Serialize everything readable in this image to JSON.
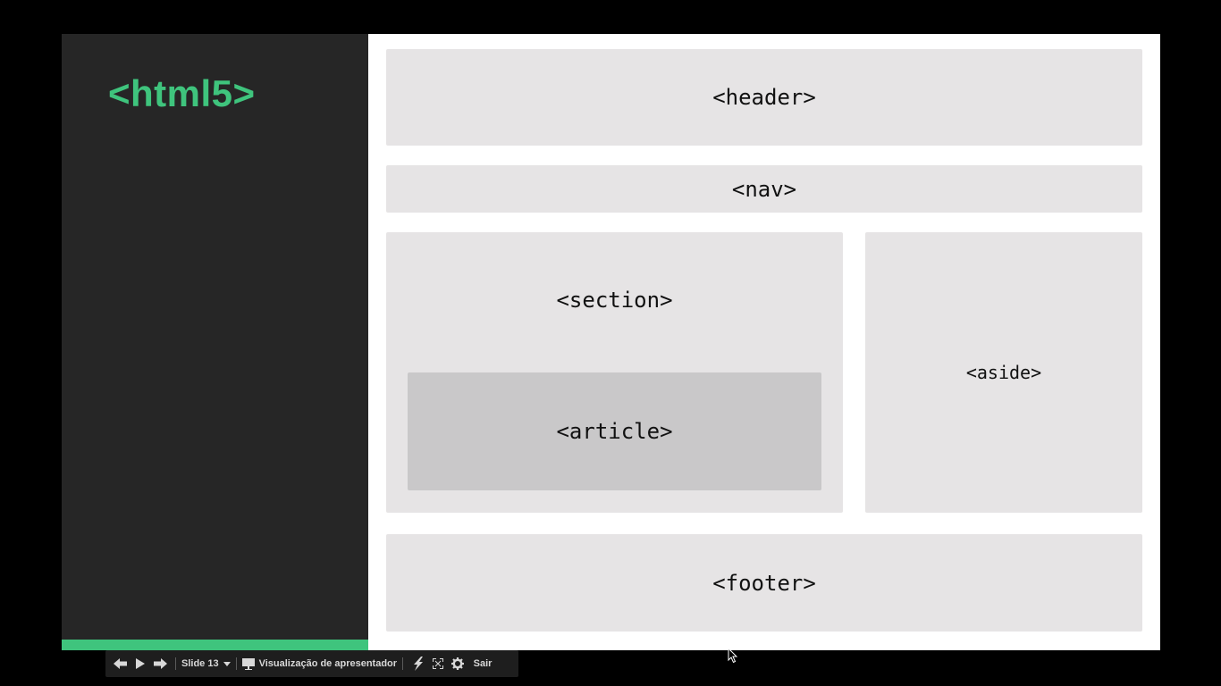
{
  "slide": {
    "title": "<html5>",
    "blocks": {
      "header": "<header>",
      "nav": "<nav>",
      "section": "<section>",
      "article": "<article>",
      "aside": "<aside>",
      "footer": "<footer>"
    }
  },
  "toolbar": {
    "prev_icon": "arrow-left-icon",
    "play_icon": "play-icon",
    "next_icon": "arrow-right-icon",
    "slide_label": "Slide 13",
    "presenter_view_icon": "presenter-screen-icon",
    "presenter_view_label": "Visualização de apresentador",
    "laser_icon": "laser-pointer-icon",
    "fullscreen_icon": "fullscreen-icon",
    "settings_icon": "gear-icon",
    "exit_label": "Sair"
  },
  "colors": {
    "accent_green": "#3fc47d",
    "sidebar_dark": "#262626",
    "block_gray": "#e6e4e5",
    "article_gray": "#c9c8c9"
  }
}
